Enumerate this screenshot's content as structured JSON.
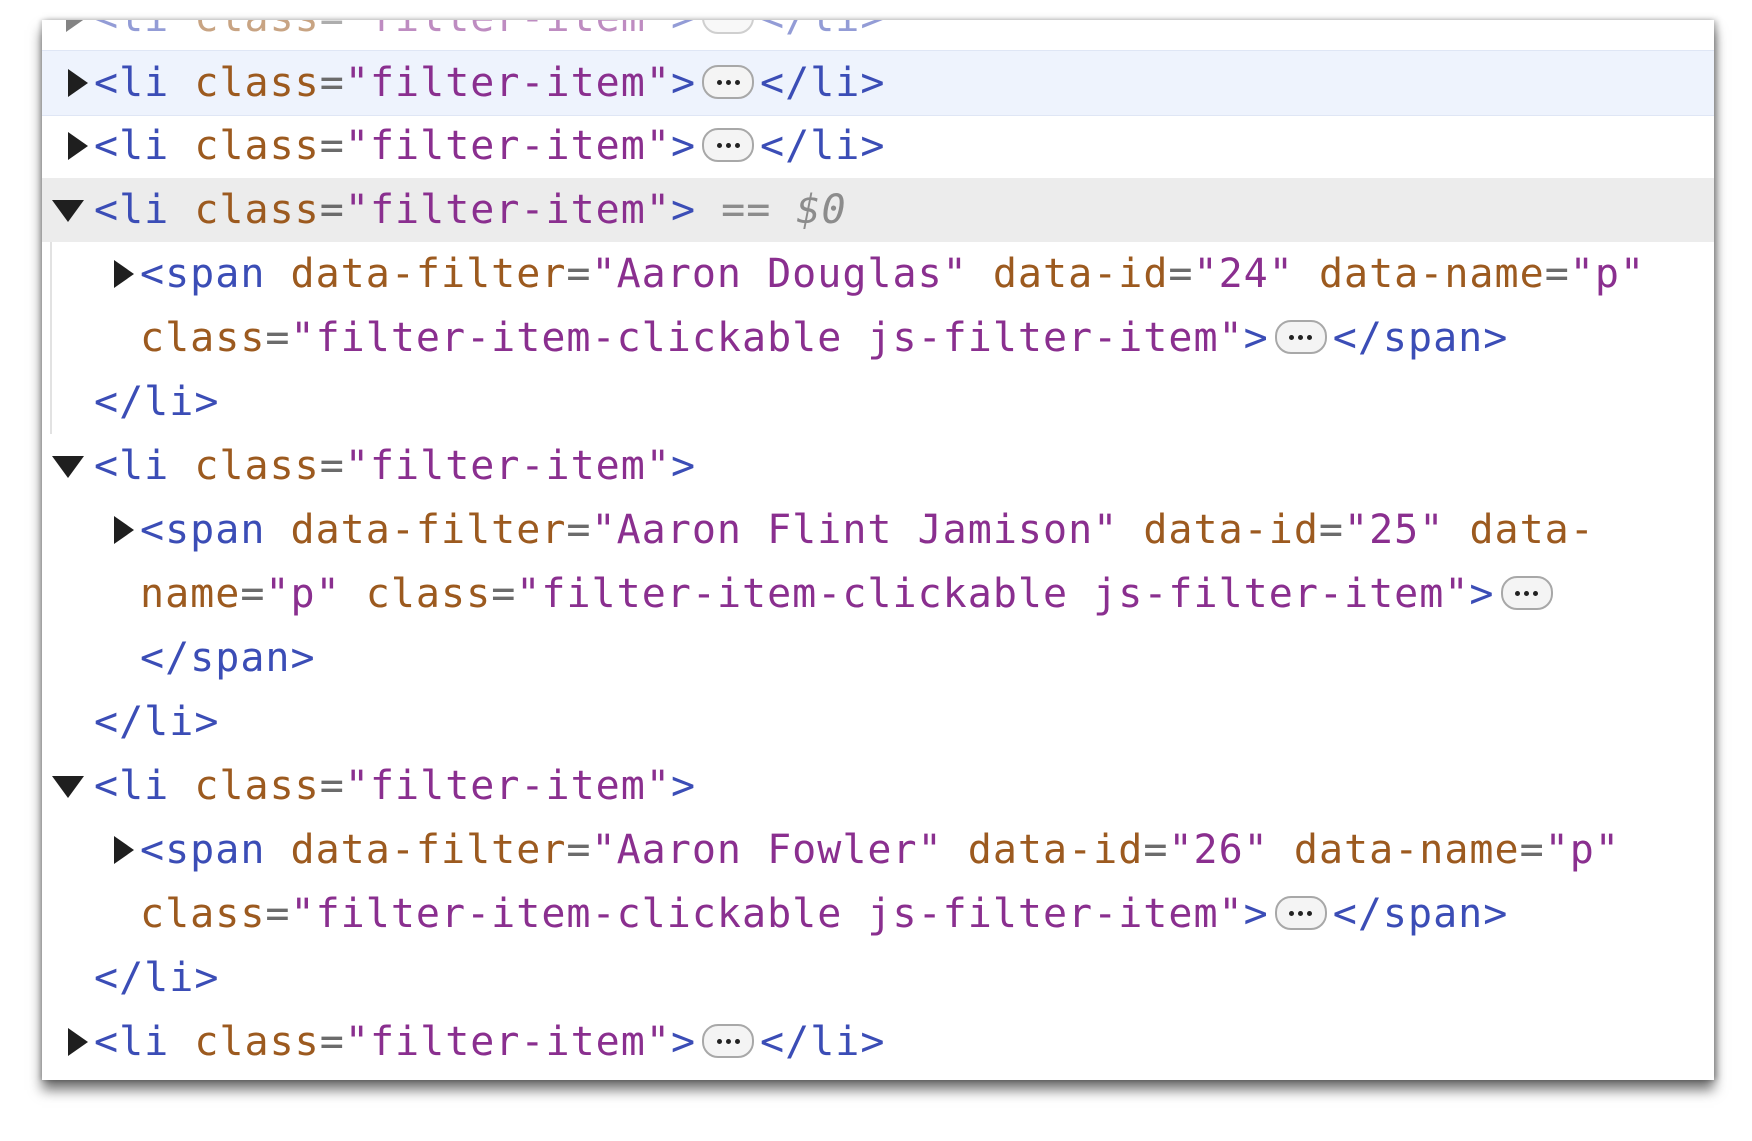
{
  "devtools_elements": {
    "rows": [
      {
        "id": "r0",
        "kind": "collapsed-li",
        "open": "<li",
        "attr": "class",
        "eq": "=",
        "value": "\"filter-item\"",
        "close_bracket": ">",
        "end": "</li>",
        "state": "clipped"
      },
      {
        "id": "r1",
        "kind": "collapsed-li",
        "open": "<li",
        "attr": "class",
        "eq": "=",
        "value": "\"filter-item\"",
        "close_bracket": ">",
        "end": "</li>",
        "state": "hover"
      },
      {
        "id": "r2",
        "kind": "collapsed-li",
        "open": "<li",
        "attr": "class",
        "eq": "=",
        "value": "\"filter-item\"",
        "close_bracket": ">",
        "end": "</li>"
      },
      {
        "id": "r3",
        "kind": "expanded-li",
        "open": "<li",
        "attr": "class",
        "eq": "=",
        "value": "\"filter-item\"",
        "close_bracket": ">",
        "selected_marker": "== $0",
        "state": "selected"
      }
    ],
    "spans": [
      {
        "data_filter": "\"Aaron Douglas\"",
        "data_id": "\"24\"",
        "data_name": "\"p\"",
        "class_value": "\"filter-item-clickable js-filter-item\""
      },
      {
        "data_filter": "\"Aaron Flint Jamison\"",
        "data_id": "\"25\"",
        "data_name": "\"p\"",
        "class_value": "\"filter-item-clickable js-filter-item\""
      },
      {
        "data_filter": "\"Aaron Fowler\"",
        "data_id": "\"26\"",
        "data_name": "\"p\"",
        "class_value": "\"filter-item-clickable js-filter-item\""
      }
    ],
    "tokens": {
      "span_open": "<span",
      "span_close": "</span>",
      "li_open": "<li",
      "li_close": "</li>",
      "attr_data_filter": "data-filter",
      "attr_data_id": "data-id",
      "attr_data_name": "data-name",
      "attr_data_name_part1": "data-",
      "attr_data_name_part2": "name",
      "attr_class": "class",
      "equals": "=",
      "gt": ">",
      "li_class_value": "\"filter-item\""
    },
    "colors": {
      "tag": "#3b4db6",
      "attribute": "#9c5a1f",
      "value": "#8a2f8f",
      "selected_bg": "#ececec",
      "hover_bg": "#eef3fd"
    },
    "icons": [
      "triangle-right-icon",
      "triangle-down-icon",
      "ellipsis-icon"
    ]
  }
}
